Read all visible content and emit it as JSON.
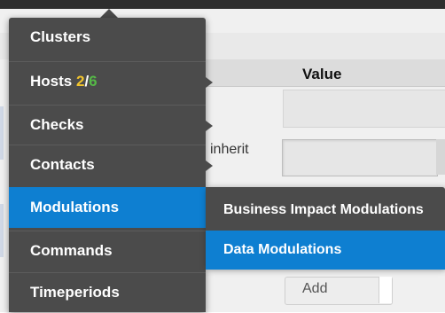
{
  "background": {
    "table_header_value": "Value",
    "inherit_label": "inherit",
    "add_select_value": "Add"
  },
  "menu": {
    "items": [
      {
        "label": "Clusters"
      },
      {
        "label": "Hosts",
        "badge_up": "2",
        "badge_sep": "/",
        "badge_total": "6"
      },
      {
        "label": "Checks"
      },
      {
        "label": "Contacts"
      },
      {
        "label": "Modulations"
      },
      {
        "label": "Commands"
      },
      {
        "label": "Timeperiods"
      }
    ]
  },
  "submenu": {
    "items": [
      {
        "label": "Business Impact Modulations"
      },
      {
        "label": "Data Modulations"
      }
    ]
  },
  "colors": {
    "menu_bg": "#4b4b4b",
    "active_blue": "#0e7fd1",
    "badge_up_yellow": "#f2c52d",
    "badge_total_green": "#55b947"
  }
}
